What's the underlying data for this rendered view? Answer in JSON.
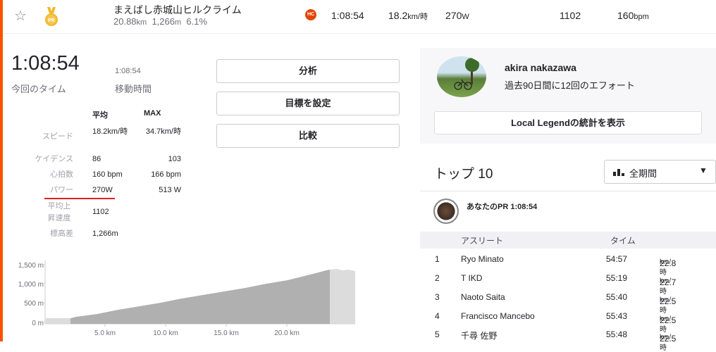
{
  "segment": {
    "name": "まえばし赤城山ヒルクライム",
    "distance": "20.88",
    "distance_unit": "km",
    "elevation": "1,266",
    "elevation_unit": "m",
    "grade": "6.1%",
    "category_badge": "HC",
    "time": "1:08:54",
    "speed": "18.2",
    "speed_unit": "km/時",
    "power": "270",
    "power_unit": "W",
    "vam": "1102",
    "heartrate": "160",
    "heartrate_unit": "bpm"
  },
  "effort": {
    "elapsed_time": "1:08:54",
    "elapsed_label": "今回のタイム",
    "moving_time": "1:08:54",
    "moving_label": "移動時間",
    "col_avg": "平均",
    "col_max": "MAX",
    "rows": [
      {
        "label": "スピード",
        "avg": "18.2km/時",
        "max": "34.7km/時"
      },
      {
        "label": "ケイデンス",
        "avg": "86",
        "max": "103"
      },
      {
        "label": "心拍数",
        "avg": "160 bpm",
        "max": "166 bpm"
      },
      {
        "label": "パワー",
        "avg": "270W",
        "max": "513 W"
      },
      {
        "label": "平均上昇速度",
        "avg": "1102",
        "max": ""
      },
      {
        "label": "標高差",
        "avg": "1,266m",
        "max": ""
      }
    ]
  },
  "actions": {
    "analyze": "分析",
    "set_goal": "目標を設定",
    "compare": "比較"
  },
  "elevation_chart": {
    "y_ticks": [
      "1,500 m",
      "1,000 m",
      "500 m",
      "0 m"
    ],
    "x_ticks": [
      "5.0 km",
      "10.0 km",
      "15.0 km",
      "20.0 km"
    ]
  },
  "local_legend": {
    "name": "akira nakazawa",
    "subtitle": "過去90日間に12回のエフォート",
    "button": "Local Legendの統計を表示"
  },
  "leaderboard": {
    "title": "トップ 10",
    "period": "全期間",
    "my_pr_label": "あなたのPR",
    "my_pr_time": "1:08:54",
    "col_athlete": "アスリート",
    "col_time": "タイム",
    "rows": [
      {
        "rank": "1",
        "name": "Ryo Minato",
        "time": "54:57",
        "speed": "22.8",
        "unit": "km/時"
      },
      {
        "rank": "2",
        "name": "T IKD",
        "time": "55:19",
        "speed": "22.7",
        "unit": "km/時"
      },
      {
        "rank": "3",
        "name": "Naoto Saita",
        "time": "55:40",
        "speed": "22.5",
        "unit": "km/時"
      },
      {
        "rank": "4",
        "name": "Francisco Mancebo",
        "time": "55:43",
        "speed": "22.5",
        "unit": "km/時"
      },
      {
        "rank": "5",
        "name": "千尋 佐野",
        "time": "55:48",
        "speed": "22.5",
        "unit": "km/時"
      }
    ]
  },
  "colors": {
    "accent": "#fc5200",
    "hc_badge": "#e34402",
    "underline": "#e02020",
    "medal": "#f2b62c"
  }
}
